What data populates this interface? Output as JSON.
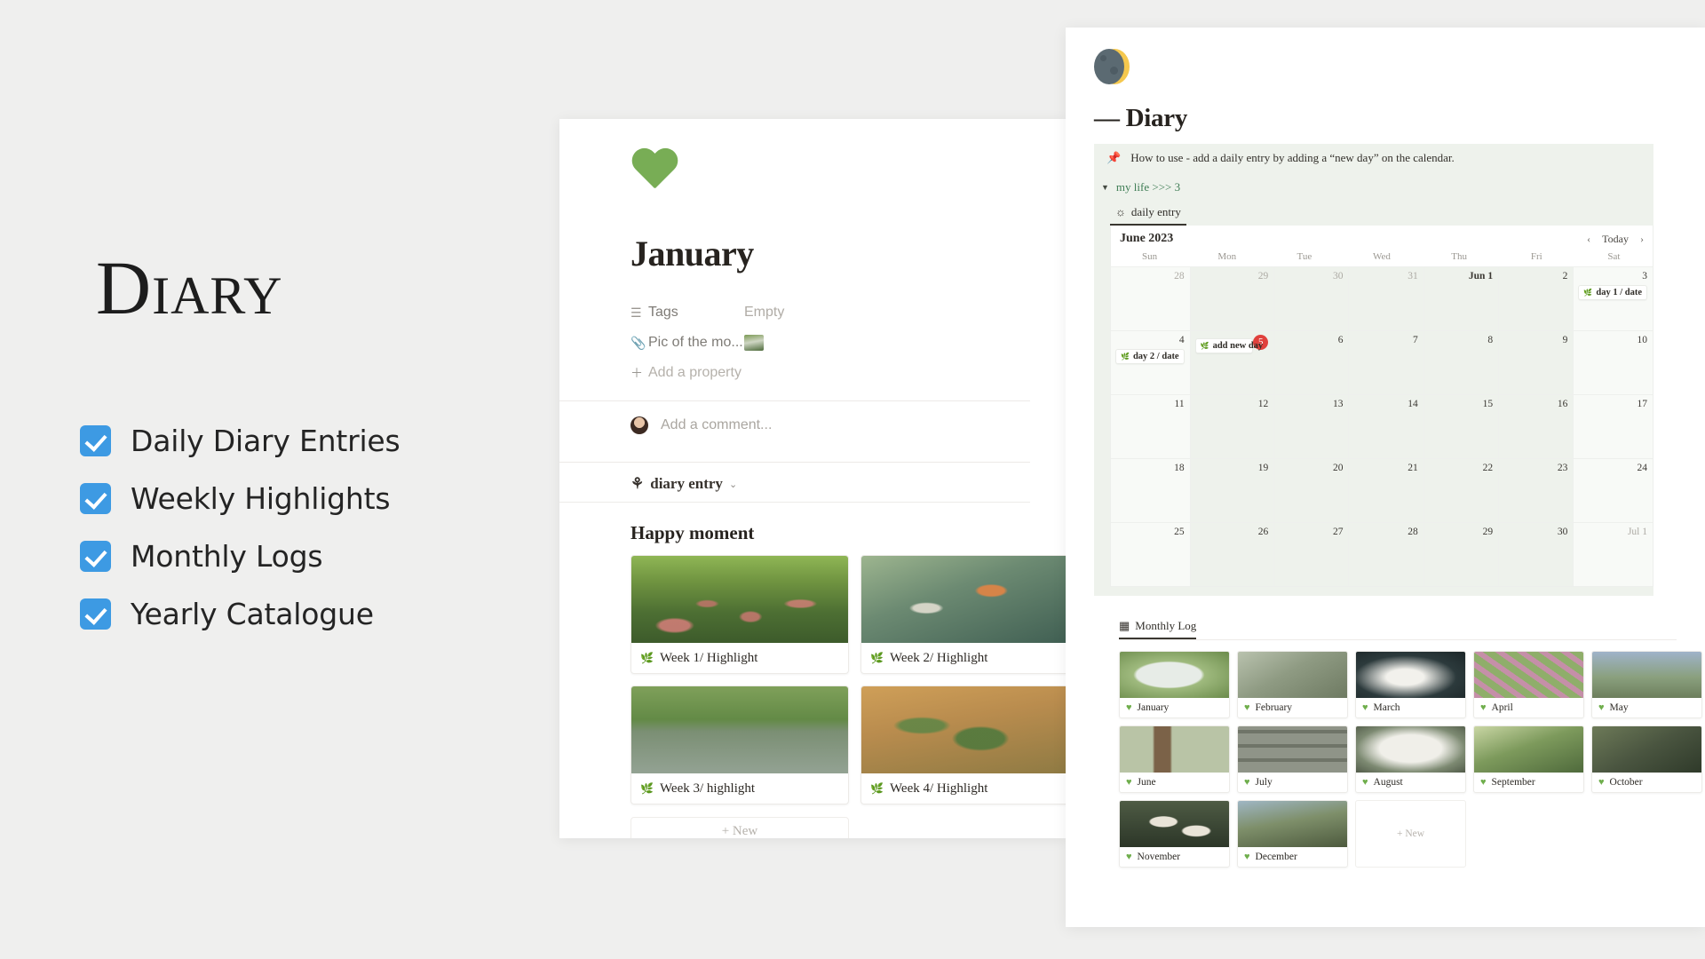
{
  "promo": {
    "title": "Diary",
    "features": [
      {
        "label": "Daily Diary Entries"
      },
      {
        "label": "Weekly Highlights"
      },
      {
        "label": "Monthly Logs"
      },
      {
        "label": "Yearly Catalogue"
      }
    ],
    "checkbox_color": "#3d9ae3",
    "background": "#efefee"
  },
  "month_page": {
    "icon": "green-heart-emoji",
    "title": "January",
    "properties": [
      {
        "icon": "list-icon",
        "key": "Tags",
        "value": "Empty"
      },
      {
        "icon": "paperclip-icon",
        "key": "Pic of the mo...",
        "value": ""
      }
    ],
    "add_property": "Add a property",
    "comment_placeholder": "Add a comment...",
    "entry_tab": "diary entry",
    "section_heading": "Happy moment",
    "cards": [
      {
        "label": "Week 1/ Highlight"
      },
      {
        "label": "Week 2/ Highlight"
      },
      {
        "label": "Week 3/ highlight"
      },
      {
        "label": "Week 4/ Highlight"
      }
    ],
    "new_label": "+  New"
  },
  "diary_page": {
    "icon": "waning-crescent-moon-emoji",
    "title": "— Diary",
    "callout": {
      "icon": "pushpin-emoji",
      "text": "How to use - add a daily entry by adding a “new day” on the calendar."
    },
    "toggle": {
      "icon": "triangle-down-icon",
      "label": "my life >>> 3",
      "color": "#3f7d55"
    },
    "database_tab": {
      "icon": "sun-icon",
      "label": "daily entry"
    },
    "calendar": {
      "month_label": "June 2023",
      "prev": "‹",
      "today": "Today",
      "next": "›",
      "weekdays": [
        "Sun",
        "Mon",
        "Tue",
        "Wed",
        "Thu",
        "Fri",
        "Sat"
      ],
      "today_marker": "5",
      "today_color": "#e0413d",
      "weeks": [
        [
          {
            "num": "28",
            "muted": true
          },
          {
            "num": "29",
            "muted": true
          },
          {
            "num": "30",
            "muted": true
          },
          {
            "num": "31",
            "muted": true
          },
          {
            "num": "Jun 1",
            "bold": true
          },
          {
            "num": "2"
          },
          {
            "num": "3",
            "item": "day 1 / date"
          }
        ],
        [
          {
            "num": "4",
            "item": "day 2 / date"
          },
          {
            "num": "5",
            "is_today": true,
            "item": "add new day"
          },
          {
            "num": "6"
          },
          {
            "num": "7"
          },
          {
            "num": "8"
          },
          {
            "num": "9"
          },
          {
            "num": "10"
          }
        ],
        [
          {
            "num": "11"
          },
          {
            "num": "12"
          },
          {
            "num": "13"
          },
          {
            "num": "14"
          },
          {
            "num": "15"
          },
          {
            "num": "16"
          },
          {
            "num": "17"
          }
        ],
        [
          {
            "num": "18"
          },
          {
            "num": "19"
          },
          {
            "num": "20"
          },
          {
            "num": "21"
          },
          {
            "num": "22"
          },
          {
            "num": "23"
          },
          {
            "num": "24"
          }
        ],
        [
          {
            "num": "25"
          },
          {
            "num": "26"
          },
          {
            "num": "27"
          },
          {
            "num": "28"
          },
          {
            "num": "29"
          },
          {
            "num": "30"
          },
          {
            "num": "Jul 1",
            "muted": true
          }
        ]
      ]
    },
    "monthly_log": {
      "icon": "gallery-grid-icon",
      "label": "Monthly Log",
      "cards": [
        {
          "label": "January"
        },
        {
          "label": "February"
        },
        {
          "label": "March"
        },
        {
          "label": "April"
        },
        {
          "label": "May"
        },
        {
          "label": "June"
        },
        {
          "label": "July"
        },
        {
          "label": "August"
        },
        {
          "label": "September"
        },
        {
          "label": "October"
        },
        {
          "label": "November"
        },
        {
          "label": "December"
        }
      ],
      "new_label": "+  New"
    }
  }
}
